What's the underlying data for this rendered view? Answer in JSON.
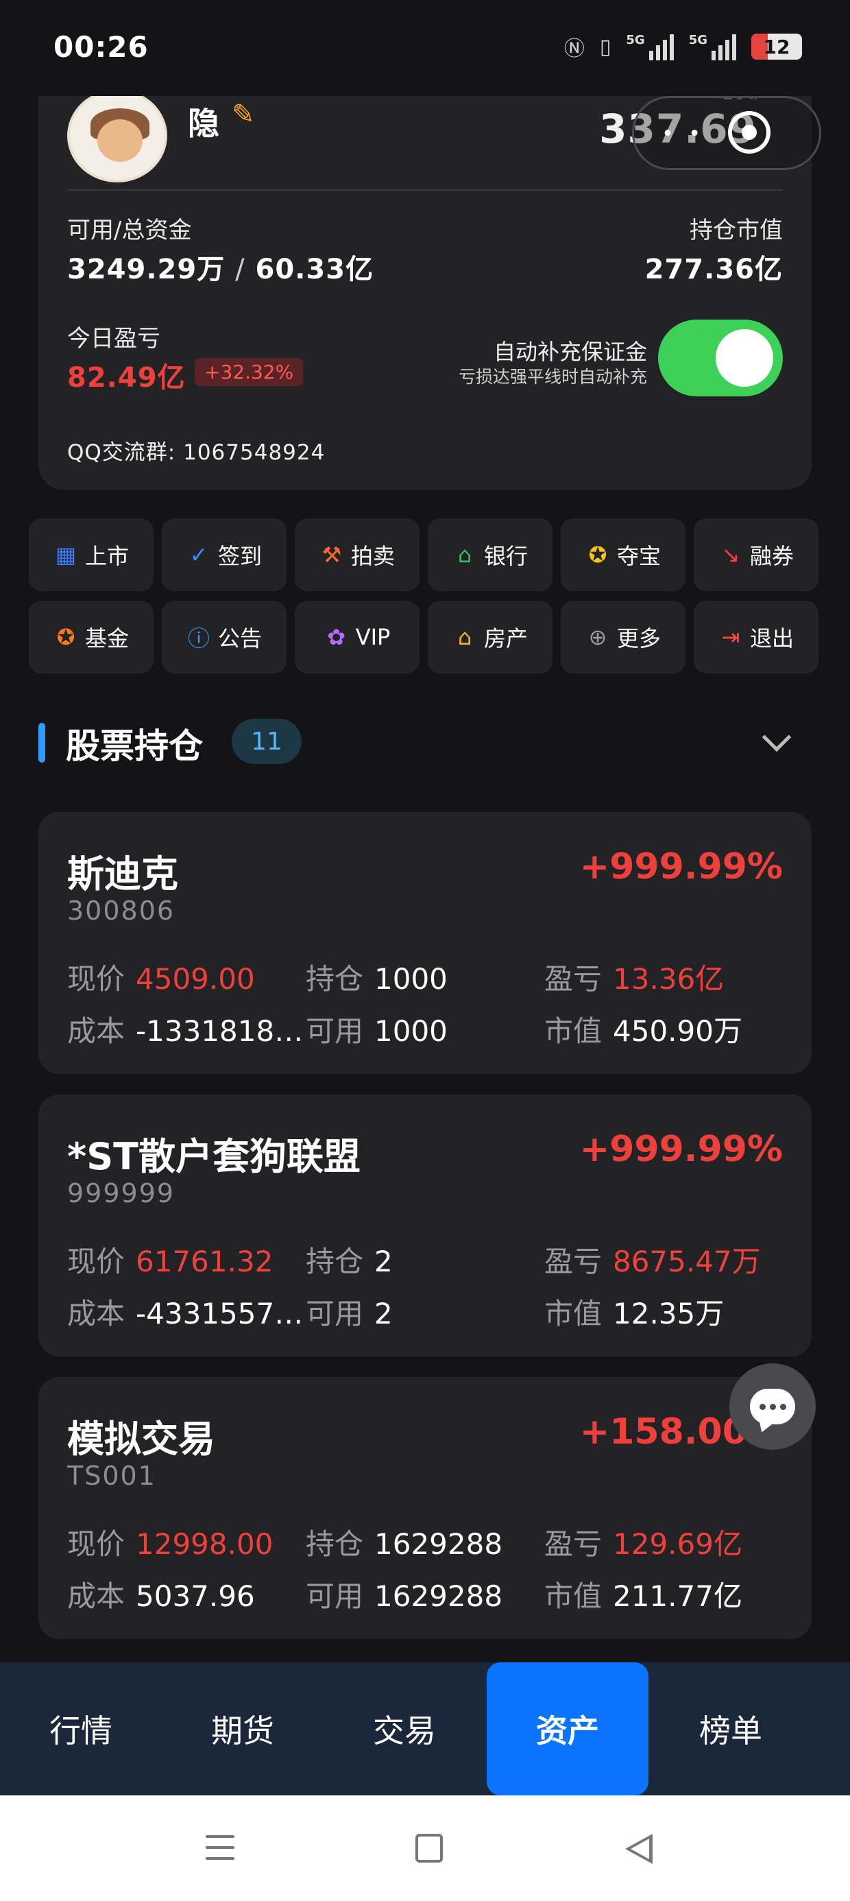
{
  "status_bar": {
    "time": "00:26",
    "nfc_icon": "nfc-icon",
    "vibrate_icon": "vibrate-icon",
    "signal1_label": "5G",
    "signal2_label": "5G",
    "battery": "12"
  },
  "account": {
    "username": "隐",
    "total_amount": "337.69",
    "total_hint": "总资产",
    "available_total_label": "可用/总资金",
    "available_value": "3249.29万",
    "separator": "/",
    "total_value": "60.33亿",
    "position_value_label": "持仓市值",
    "position_value": "277.36亿",
    "today_pnl_label": "今日盈亏",
    "today_pnl_value": "82.49亿",
    "today_pnl_pct": "+32.32%",
    "auto_margin_title": "自动补充保证金",
    "auto_margin_sub": "亏损达强平线时自动补充",
    "auto_margin_on": true,
    "qq_group": "QQ交流群: 1067548924"
  },
  "menu": [
    {
      "label": "上市",
      "icon": "building-icon",
      "color": "#3d7bff",
      "glyph": "▦"
    },
    {
      "label": "签到",
      "icon": "check-circle-icon",
      "color": "#3d8bff",
      "glyph": "✓"
    },
    {
      "label": "拍卖",
      "icon": "gavel-icon",
      "color": "#ff6a2b",
      "glyph": "⚒"
    },
    {
      "label": "银行",
      "icon": "bank-icon",
      "color": "#2fbf71",
      "glyph": "⌂"
    },
    {
      "label": "夺宝",
      "icon": "star-icon",
      "color": "#f5c518",
      "glyph": "✪"
    },
    {
      "label": "融券",
      "icon": "trend-down-icon",
      "color": "#ff3b3b",
      "glyph": "↘"
    },
    {
      "label": "基金",
      "icon": "fund-star-icon",
      "color": "#ff7a1a",
      "glyph": "✪"
    },
    {
      "label": "公告",
      "icon": "info-icon",
      "color": "#2f9bff",
      "glyph": "ⓘ"
    },
    {
      "label": "VIP",
      "icon": "vip-badge-icon",
      "color": "#b86bff",
      "glyph": "✿"
    },
    {
      "label": "房产",
      "icon": "house-icon",
      "color": "#ffb21a",
      "glyph": "⌂"
    },
    {
      "label": "更多",
      "icon": "plus-circle-icon",
      "color": "#9a9a9e",
      "glyph": "⊕"
    },
    {
      "label": "退出",
      "icon": "logout-icon",
      "color": "#ff4a3c",
      "glyph": "⇥"
    }
  ],
  "holdings": {
    "title": "股票持仓",
    "count": "11",
    "labels": {
      "price": "现价",
      "position": "持仓",
      "pnl": "盈亏",
      "cost": "成本",
      "available": "可用",
      "market_value": "市值"
    },
    "items": [
      {
        "name": "斯迪克",
        "code": "300806",
        "pct": "+999.99%",
        "price": "4509.00",
        "position": "1000",
        "pnl": "13.36亿",
        "cost": "-1331818.…",
        "available": "1000",
        "market_value": "450.90万"
      },
      {
        "name": "*ST散户套狗联盟",
        "code": "999999",
        "pct": "+999.99%",
        "price": "61761.32",
        "position": "2",
        "pnl": "8675.47万",
        "cost": "-4331557…",
        "available": "2",
        "market_value": "12.35万"
      },
      {
        "name": "模拟交易",
        "code": "TS001",
        "pct": "+158.00%",
        "price": "12998.00",
        "position": "1629288",
        "pnl": "129.69亿",
        "cost": "5037.96",
        "available": "1629288",
        "market_value": "211.77亿"
      }
    ]
  },
  "tabs": [
    {
      "label": "行情",
      "active": false
    },
    {
      "label": "期货",
      "active": false
    },
    {
      "label": "交易",
      "active": false
    },
    {
      "label": "资产",
      "active": true
    },
    {
      "label": "榜单",
      "active": false
    }
  ]
}
